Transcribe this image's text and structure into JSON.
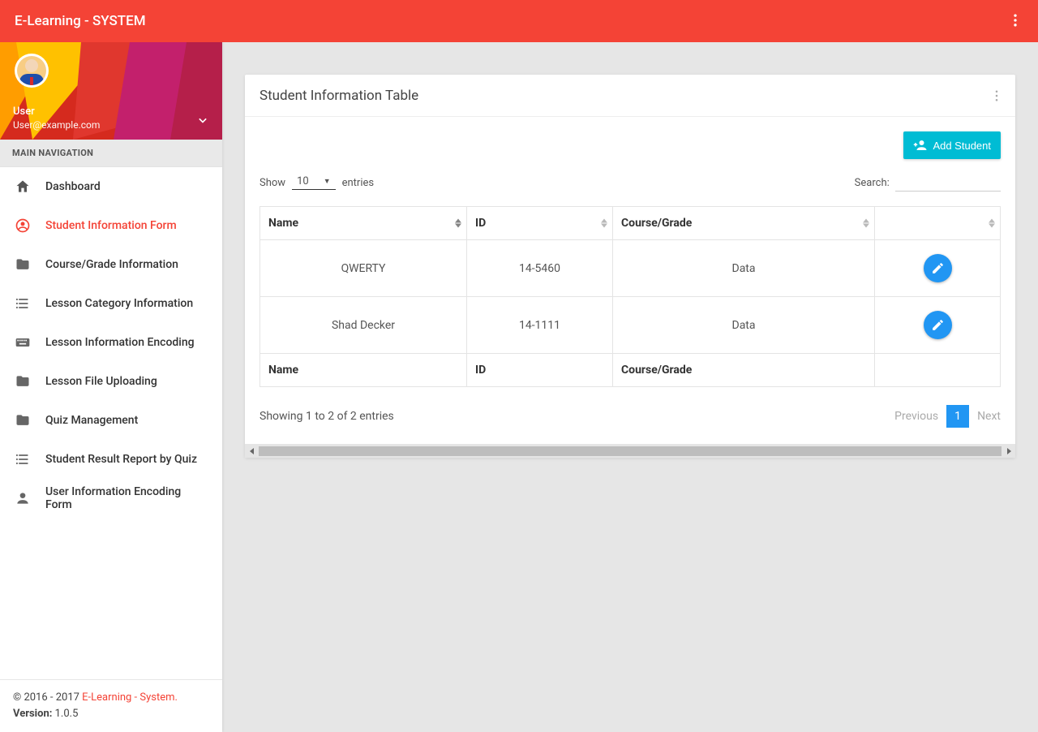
{
  "app": {
    "title": "E-Learning - SYSTEM"
  },
  "user": {
    "name": "User",
    "email": "User@example.com"
  },
  "sidebar": {
    "section_label": "MAIN NAVIGATION",
    "items": [
      {
        "label": "Dashboard"
      },
      {
        "label": "Student Information Form"
      },
      {
        "label": "Course/Grade Information"
      },
      {
        "label": "Lesson Category Information"
      },
      {
        "label": "Lesson Information Encoding"
      },
      {
        "label": "Lesson File Uploading"
      },
      {
        "label": "Quiz Management"
      },
      {
        "label": "Student Result Report by Quiz"
      },
      {
        "label": "User Information Encoding Form"
      }
    ]
  },
  "footer": {
    "copyright_prefix": "© 2016 - 2017 ",
    "link_text": "E-Learning - System.",
    "version_label": "Version:",
    "version_value": " 1.0.5"
  },
  "card": {
    "title": "Student Information Table"
  },
  "buttons": {
    "add_student": "Add Student"
  },
  "table_controls": {
    "show_label": "Show",
    "entries_label": "entries",
    "length_value": "10",
    "search_label": "Search:"
  },
  "table": {
    "headers": {
      "name": "Name",
      "id": "ID",
      "course": "Course/Grade"
    },
    "rows": [
      {
        "name": "QWERTY",
        "id": "14-5460",
        "course": "Data"
      },
      {
        "name": "Shad Decker",
        "id": "14-1111",
        "course": "Data"
      }
    ],
    "footers": {
      "name": "Name",
      "id": "ID",
      "course": "Course/Grade"
    }
  },
  "pagination": {
    "info": "Showing 1 to 2 of 2 entries",
    "previous": "Previous",
    "next": "Next",
    "page": "1"
  }
}
